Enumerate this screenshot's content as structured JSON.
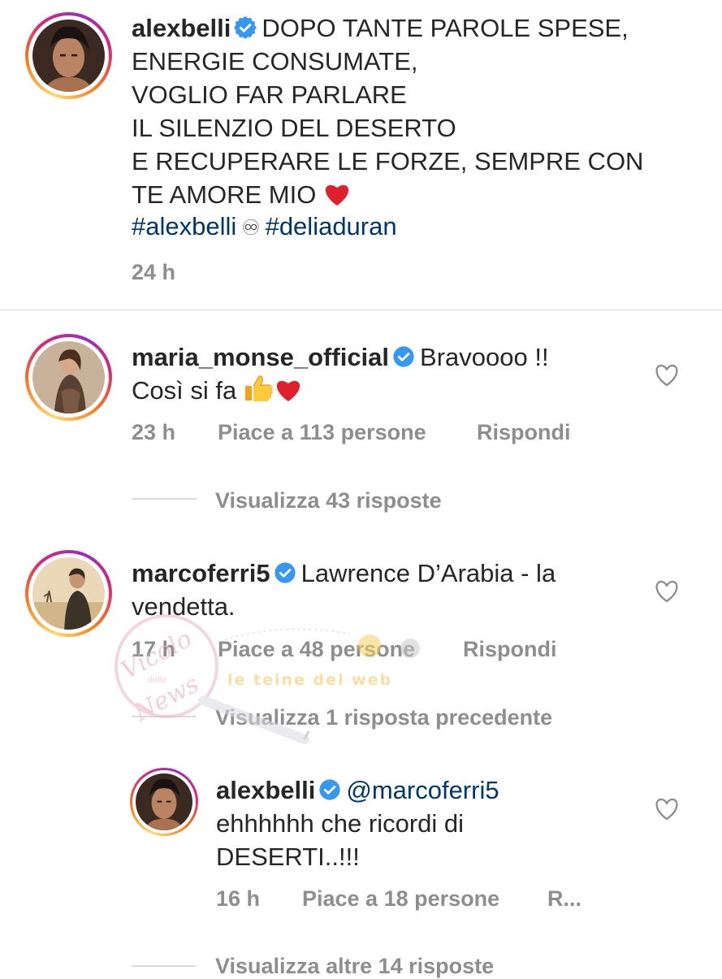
{
  "post": {
    "username": "alexbelli",
    "caption_lines": [
      "DOPO TANTE PAROLE SPESE,",
      "ENERGIE CONSUMATE,",
      "VOGLIO FAR PARLARE",
      "IL SILENZIO DEL DESERTO",
      "E RECUPERARE LE FORZE, SEMPRE CON",
      "TE AMORE MIO"
    ],
    "hashtag_1": "#alexbelli",
    "separator": "♾",
    "hashtag_2": "#deliaduran",
    "time": "24 h"
  },
  "comments": [
    {
      "username": "maria_monse_official",
      "text_line1": "Bravoooo !!",
      "text_line2": "Così si fa",
      "time": "23 h",
      "likes": "Piace a 113 persone",
      "reply": "Rispondi",
      "view_replies": "Visualizza 43 risposte"
    },
    {
      "username": "marcoferri5",
      "text_line1": "Lawrence D’Arabia - la",
      "text_line2": "vendetta.",
      "time": "17 h",
      "likes": "Piace a 48 persone",
      "reply": "Rispondi",
      "view_previous": "Visualizza 1 risposta precedente",
      "nested_reply": {
        "username": "alexbelli",
        "mention": "@marcoferri5",
        "text_line1": "ehhhhhh che ricordi di",
        "text_line2": "DESERTI..!!!",
        "time": "16 h",
        "likes": "Piace a 18 persone",
        "reply": "R..."
      },
      "view_more": "Visualizza altre 14 risposte"
    }
  ],
  "watermark": {
    "left_text_1": "Vicolo",
    "left_text_small": "delle",
    "left_text_2": "News",
    "right_text": "le teine del web"
  },
  "colors": {
    "text": "#262626",
    "secondary": "#8e8e8e",
    "link": "#00376b",
    "verified": "#3897f0",
    "heart_emoji": "#e0202f",
    "divider": "#dbdbdb"
  }
}
